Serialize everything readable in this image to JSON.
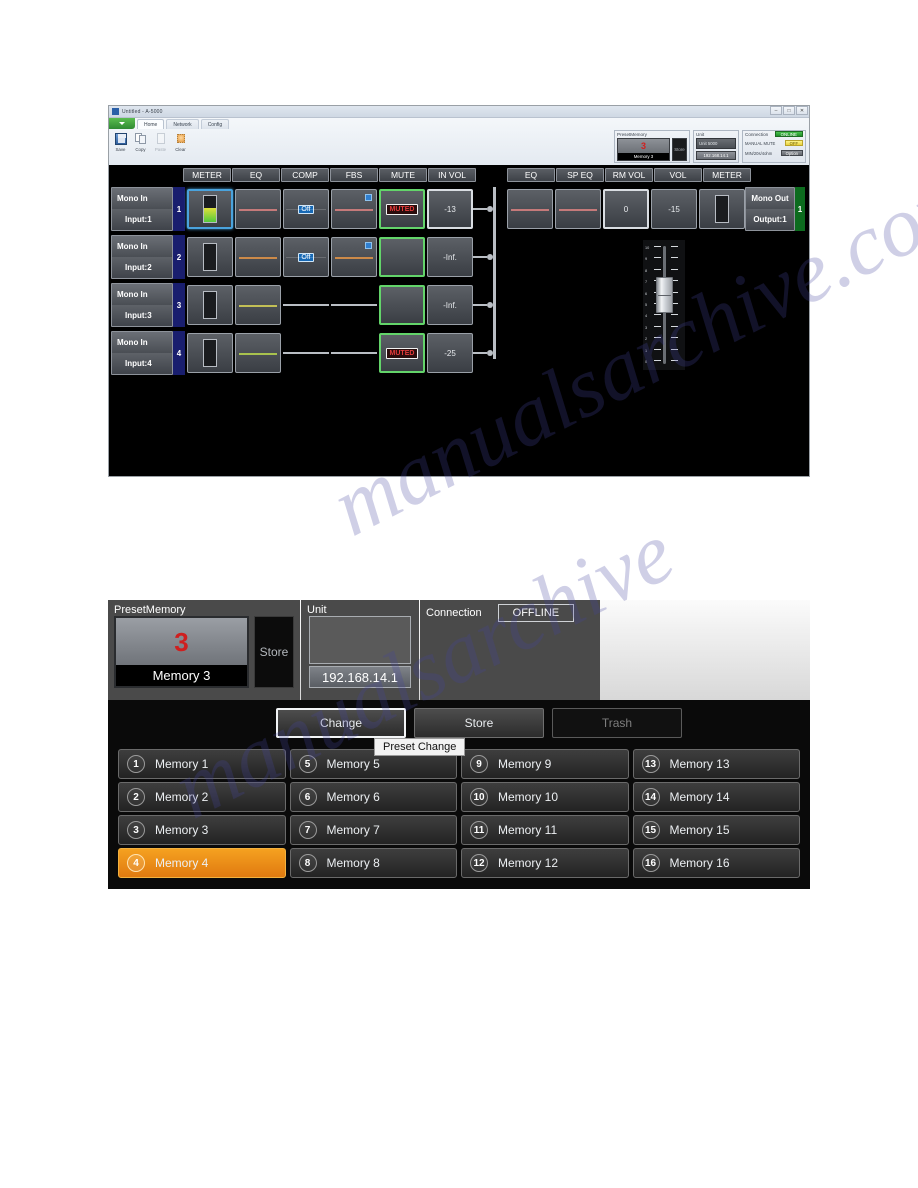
{
  "watermark": {
    "line1": "manualsarchive.com",
    "line2": "manualsarchive"
  },
  "app_window": {
    "title": "Untitled - A-5000",
    "window_buttons": {
      "minimize": "–",
      "maximize": "□",
      "close": "✕"
    },
    "ribbon": {
      "orb_label": "",
      "tabs": [
        {
          "label": "Home",
          "active": true
        },
        {
          "label": "Network",
          "active": false
        },
        {
          "label": "Config",
          "active": false
        }
      ],
      "commands": [
        {
          "label": "Save",
          "icon": "save-icon",
          "disabled": false
        },
        {
          "label": "Copy",
          "icon": "copy-icon",
          "disabled": false
        },
        {
          "label": "Paste",
          "icon": "paste-icon",
          "disabled": true
        },
        {
          "label": "Clear",
          "icon": "clear-icon",
          "disabled": false
        }
      ],
      "preset_pane": {
        "header": "PresetMemory",
        "number": "3",
        "name": "Memory 3",
        "store_label": "Store"
      },
      "unit_pane": {
        "header": "Unit",
        "model": "Unit 5000",
        "ip": "192.168.14.1"
      },
      "connection_pane": {
        "header": "Connection",
        "status": "ONLINE",
        "rows": [
          {
            "label": "MANUAL MUTE",
            "value": "OFF",
            "style": "yellow"
          },
          {
            "label": "MIN/20s/4ohm",
            "value": "Option",
            "style": "gray"
          }
        ]
      }
    },
    "mixer": {
      "input_columns": [
        "METER",
        "EQ",
        "COMP",
        "FBS",
        "MUTE",
        "IN VOL"
      ],
      "output_columns": [
        "EQ",
        "SP EQ",
        "RM VOL",
        "VOL",
        "METER"
      ],
      "channels": [
        {
          "type": "Mono In",
          "number": "1",
          "name": "Input:1",
          "meter_level": 55,
          "meter_selected": true,
          "eq_color": "#c57a7a",
          "comp": "Off",
          "comp_present": true,
          "fbs_present": true,
          "mute": "MUTED",
          "mute_on": true,
          "in_vol": "-13",
          "in_vol_selected": true
        },
        {
          "type": "Mono In",
          "number": "2",
          "name": "Input:2",
          "meter_level": 0,
          "meter_selected": false,
          "eq_color": "#cc8a49",
          "comp": "Off",
          "comp_present": true,
          "fbs_present": true,
          "mute": "",
          "mute_on": false,
          "in_vol": "-Inf.",
          "in_vol_selected": false
        },
        {
          "type": "Mono In",
          "number": "3",
          "name": "Input:3",
          "meter_level": 0,
          "meter_selected": false,
          "eq_color": "#c2bf56",
          "comp": "",
          "comp_present": false,
          "fbs_present": false,
          "mute": "",
          "mute_on": false,
          "in_vol": "-Inf.",
          "in_vol_selected": false
        },
        {
          "type": "Mono In",
          "number": "4",
          "name": "Input:4",
          "meter_level": 0,
          "meter_selected": false,
          "eq_color": "#a8c24e",
          "comp": "",
          "comp_present": false,
          "fbs_present": false,
          "mute": "MUTED",
          "mute_on": true,
          "in_vol": "-25",
          "in_vol_selected": false
        }
      ],
      "output": {
        "type": "Mono Out",
        "number": "1",
        "name": "Output:1",
        "eq_color": "#c57a7a",
        "sp_eq_color": "#c57a7a",
        "rm_vol": "0",
        "vol": "-15",
        "meter_level": 0,
        "rm_vol_selected": true
      },
      "fader": {
        "ticks": [
          "10",
          "9",
          "8",
          "7",
          "6",
          "5",
          "4",
          "3",
          "2",
          "1",
          "0"
        ],
        "value": 6.6
      }
    }
  },
  "bottom_panel": {
    "preset_section": {
      "header": "PresetMemory",
      "number": "3",
      "name": "Memory 3",
      "store_label": "Store"
    },
    "unit_section": {
      "header": "Unit",
      "ip": "192.168.14.1"
    },
    "connection_section": {
      "header": "Connection",
      "status": "OFFLINE"
    },
    "action_buttons": [
      {
        "label": "Change",
        "state": "selected"
      },
      {
        "label": "Store",
        "state": "normal"
      },
      {
        "label": "Trash",
        "state": "disabled"
      }
    ],
    "tooltip": "Preset Change",
    "memories": [
      {
        "num": "1",
        "name": "Memory 1",
        "active": false
      },
      {
        "num": "2",
        "name": "Memory 2",
        "active": false
      },
      {
        "num": "3",
        "name": "Memory 3",
        "active": false
      },
      {
        "num": "4",
        "name": "Memory 4",
        "active": true
      },
      {
        "num": "5",
        "name": "Memory 5",
        "active": false
      },
      {
        "num": "6",
        "name": "Memory 6",
        "active": false
      },
      {
        "num": "7",
        "name": "Memory 7",
        "active": false
      },
      {
        "num": "8",
        "name": "Memory 8",
        "active": false
      },
      {
        "num": "9",
        "name": "Memory 9",
        "active": false
      },
      {
        "num": "10",
        "name": "Memory 10",
        "active": false
      },
      {
        "num": "11",
        "name": "Memory 11",
        "active": false
      },
      {
        "num": "12",
        "name": "Memory 12",
        "active": false
      },
      {
        "num": "13",
        "name": "Memory 13",
        "active": false
      },
      {
        "num": "14",
        "name": "Memory 14",
        "active": false
      },
      {
        "num": "15",
        "name": "Memory 15",
        "active": false
      },
      {
        "num": "16",
        "name": "Memory 16",
        "active": false
      }
    ]
  },
  "colors": {
    "accent_orange": "#e88a14",
    "online_green": "#2f9e35",
    "preset_red": "#cf1f1f",
    "mute_red": "#e33b3b",
    "select_blue": "#4aa3dd",
    "channel_blue": "#191e6e"
  }
}
